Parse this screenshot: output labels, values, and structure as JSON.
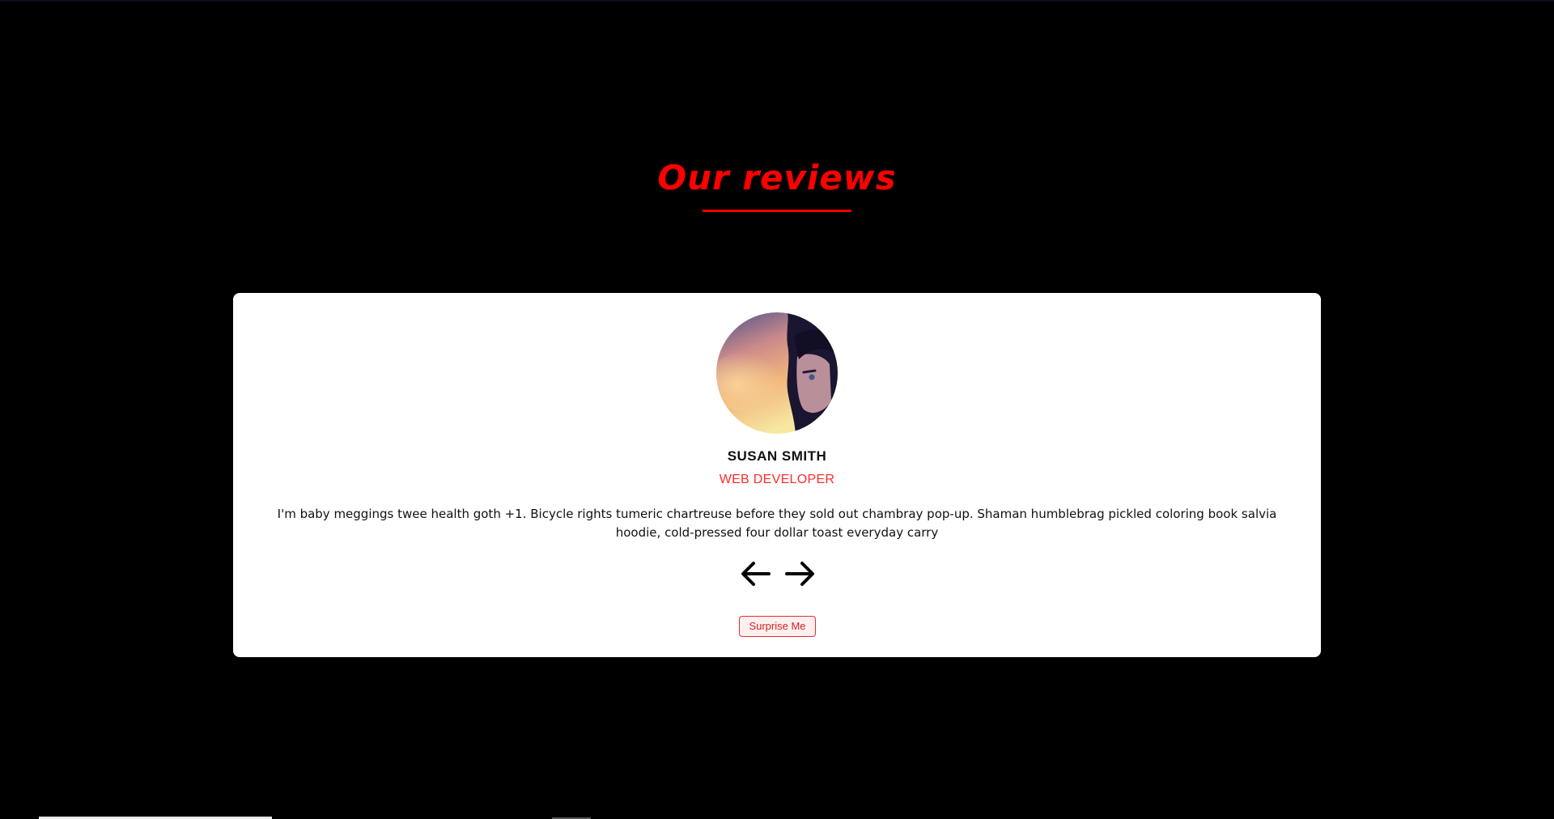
{
  "section": {
    "title": "Our reviews"
  },
  "review": {
    "name": "SUSAN SMITH",
    "job": "WEB DEVELOPER",
    "text": "I'm baby meggings twee health goth +1. Bicycle rights tumeric chartreuse before they sold out chambray pop-up. Shaman humblebrag pickled coloring book salvia hoodie, cold-pressed four dollar toast everyday carry",
    "avatar_icon": "person-portrait-icon"
  },
  "controls": {
    "prev_icon": "arrow-left-icon",
    "next_icon": "arrow-right-icon",
    "surprise_label": "Surprise Me"
  },
  "colors": {
    "accent": "#ff0000",
    "background": "#000000",
    "card": "#ffffff"
  }
}
